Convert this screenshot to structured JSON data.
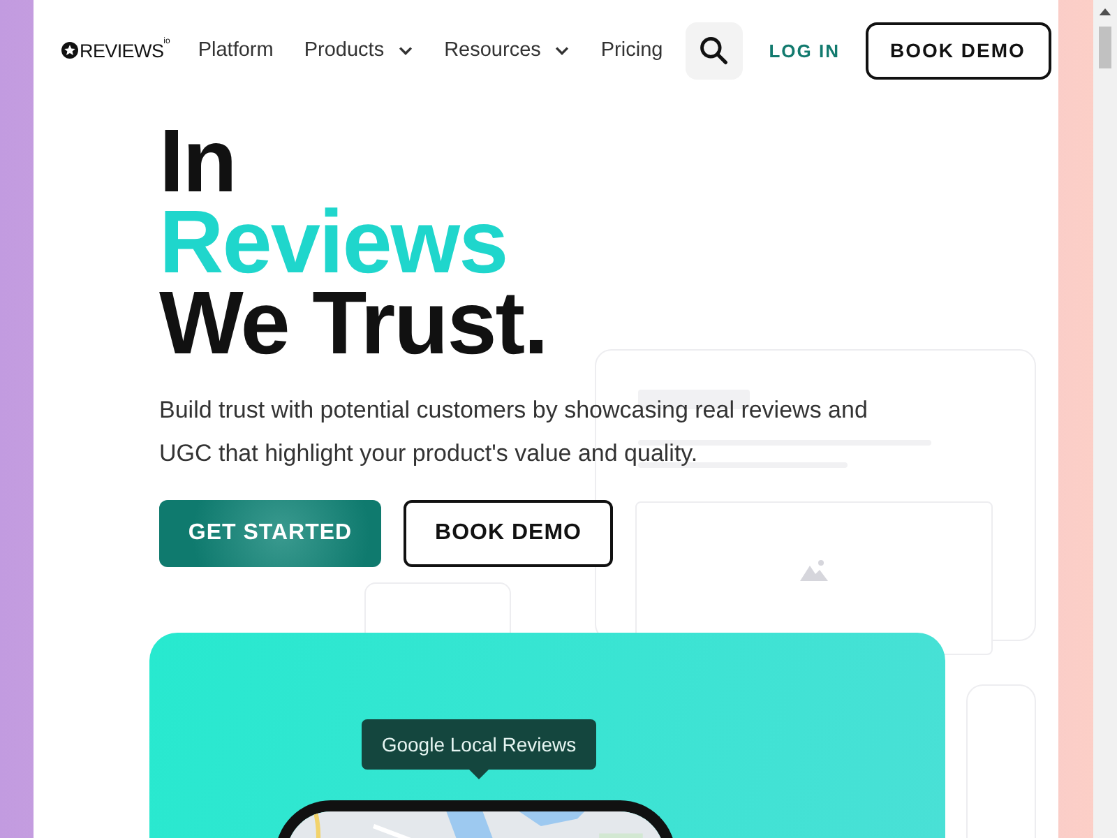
{
  "header": {
    "logo": {
      "name": "REVIEWS",
      "suffix": "io"
    },
    "nav": [
      {
        "label": "Platform",
        "dropdown": false
      },
      {
        "label": "Products",
        "dropdown": true
      },
      {
        "label": "Resources",
        "dropdown": true
      },
      {
        "label": "Pricing",
        "dropdown": false
      }
    ],
    "login": "LOG IN",
    "book_demo": "BOOK DEMO"
  },
  "hero": {
    "headline": [
      {
        "text": "In",
        "accent": false
      },
      {
        "text": "Reviews",
        "accent": true
      },
      {
        "text": "We Trust.",
        "accent": false
      }
    ],
    "description": "Build trust with potential customers by showcasing real reviews and UGC that highlight your product's value and quality.",
    "primary_button": "GET STARTED",
    "secondary_button": "BOOK DEMO"
  },
  "showcase": {
    "tooltip": "Google Local Reviews"
  }
}
